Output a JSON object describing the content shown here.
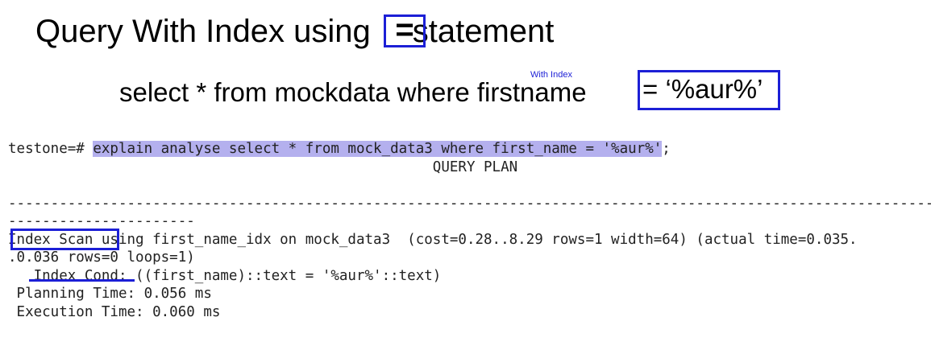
{
  "slide": {
    "title_before": "Query With Index using",
    "title_operator": "=",
    "title_after": "statement",
    "note": "With Index",
    "sql_prefix": "select * from mockdata where firstname",
    "sql_value": "= ‘%aur%’"
  },
  "terminal": {
    "prompt": "testone=# ",
    "command": "explain analyse select * from mock_data3 where first_name = '%aur%'",
    "command_end": ";",
    "plan_header": "                                                  QUERY PLAN",
    "blank": "",
    "separator_1": "------------------------------------------------------------------------------------------------------------------------",
    "separator_2": "----------------------",
    "scan_keyword": "Index Scan",
    "scan_rest": " using first_name_idx on mock_data3  (cost=0.28..8.29 rows=1 width=64) (actual time=0.035.",
    "scan_cont": ".0.036 rows=0 loops=1)",
    "cond_line": "   Index Cond: ((first_name)::text = '%aur%'::text)",
    "planning_line": " Planning Time: 0.056 ms",
    "execution_line": " Execution Time: 0.060 ms"
  },
  "colors": {
    "accent_blue": "#1c1fd6",
    "highlight": "#b4b0ee"
  }
}
